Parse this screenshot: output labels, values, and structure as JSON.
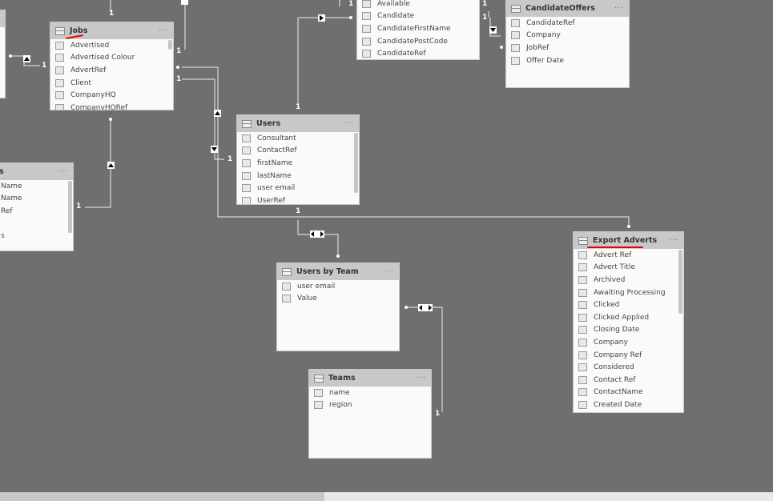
{
  "tables": {
    "left_top": {
      "title": "",
      "fields": []
    },
    "jobs": {
      "title": "Jobs",
      "fields": [
        "Advertised",
        "Advertised Colour",
        "AdvertRef",
        "Client",
        "CompanyHQ",
        "CompanyHQRef"
      ]
    },
    "left_bottom": {
      "title": "s",
      "fields": [
        " Name",
        "Name",
        "Ref",
        "",
        "s"
      ]
    },
    "candidate": {
      "title": "",
      "fields": [
        "Available",
        "Candidate",
        "CandidateFirstName",
        "CandidatePostCode",
        "CandidateRef"
      ]
    },
    "candidate_offers": {
      "title": "CandidateOffers",
      "fields": [
        "CandidateRef",
        "Company",
        "JobRef",
        "Offer Date"
      ]
    },
    "users": {
      "title": "Users",
      "fields": [
        "Consultant",
        "ContactRef",
        "firstName",
        "lastName",
        "user email",
        "UserRef"
      ]
    },
    "export_adverts": {
      "title": "Export Adverts",
      "fields": [
        "Advert Ref",
        "Advert Title",
        "Archived",
        "Awaiting Processing",
        "Clicked",
        "Clicked Applied",
        "Closing Date",
        "Company",
        "Company Ref",
        "Considered",
        "Contact Ref",
        "ContactName",
        "Created Date"
      ]
    },
    "users_by_team": {
      "title": "Users by Team",
      "fields": [
        "user email",
        "Value"
      ]
    },
    "teams": {
      "title": "Teams",
      "fields": [
        "name",
        "region"
      ]
    }
  },
  "more_label": "···",
  "cardinality_one": "1",
  "scroll": {
    "horizontal_position": 0.42
  },
  "colors": {
    "canvas": "#6f6f6f",
    "header": "#c8c8c8",
    "annotation": "#e00000"
  }
}
